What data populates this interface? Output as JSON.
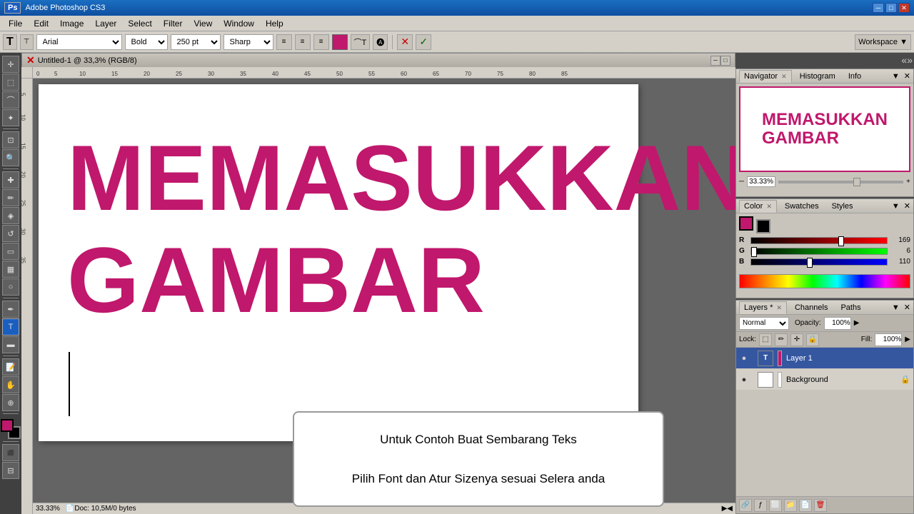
{
  "app": {
    "title": "Adobe Photoshop CS3",
    "ps_label": "Ps"
  },
  "titlebar": {
    "title": "Adobe Photoshop CS3",
    "minimize": "─",
    "maximize": "□",
    "close": "✕"
  },
  "menubar": {
    "items": [
      "File",
      "Edit",
      "Image",
      "Layer",
      "Select",
      "Filter",
      "View",
      "Window",
      "Help"
    ]
  },
  "toolbar_options": {
    "font": "Arial",
    "style": "Bold",
    "size": "250 pt",
    "aa": "Sharp",
    "align_left": "≡",
    "align_center": "≡",
    "align_right": "≡",
    "commit": "✓",
    "cancel": "✕",
    "workspace": "Workspace ▼"
  },
  "document": {
    "title": "Untitled-1 @ 33,3% (RGB/8)",
    "zoom": "33.33%",
    "doc_size": "Doc: 10,5M/0 bytes"
  },
  "canvas": {
    "text_line1": "MEMASUKKAN",
    "text_line2": "GAMBAR",
    "color": "#c0186c"
  },
  "tooltip": {
    "line1": "Untuk Contoh Buat Sembarang Teks",
    "line2": "Pilih Font dan Atur Sizenya sesuai Selera anda"
  },
  "navigator": {
    "tab": "Navigator",
    "zoom_value": "33.33%"
  },
  "histogram": {
    "tab": "Histogram"
  },
  "info_tab": {
    "tab": "Info"
  },
  "color_panel": {
    "tab": "Color",
    "r_label": "R",
    "r_value": "169",
    "g_label": "G",
    "g_value": "6",
    "b_label": "B",
    "b_value": "110"
  },
  "swatches": {
    "tab": "Swatches"
  },
  "styles": {
    "tab": "Styles"
  },
  "layers_panel": {
    "tab": "Layers *",
    "channels_tab": "Channels",
    "paths_tab": "Paths",
    "mode": "Normal",
    "opacity_label": "Opacity:",
    "opacity_value": "100%",
    "lock_label": "Lock:",
    "fill_label": "Fill:",
    "fill_value": "100%",
    "layers": [
      {
        "name": "Layer 1",
        "type": "text",
        "visible": true,
        "locked": false
      },
      {
        "name": "Background",
        "type": "bg",
        "visible": true,
        "locked": true
      }
    ]
  },
  "status": {
    "zoom": "33.33%",
    "doc_size": "Doc: 10,5M/0 bytes"
  },
  "icons": {
    "eye": "●",
    "lock": "🔒",
    "text_t": "T",
    "move": "✛",
    "lasso": "⌒",
    "crop": "⊡",
    "pencil": "✏",
    "brush": "🖌",
    "clone": "✿",
    "eraser": "◻",
    "gradient": "▦",
    "dodge": "◔",
    "type": "T",
    "pen": "✒",
    "shape": "▭",
    "zoom_tool": "⊕",
    "hand": "✋"
  }
}
